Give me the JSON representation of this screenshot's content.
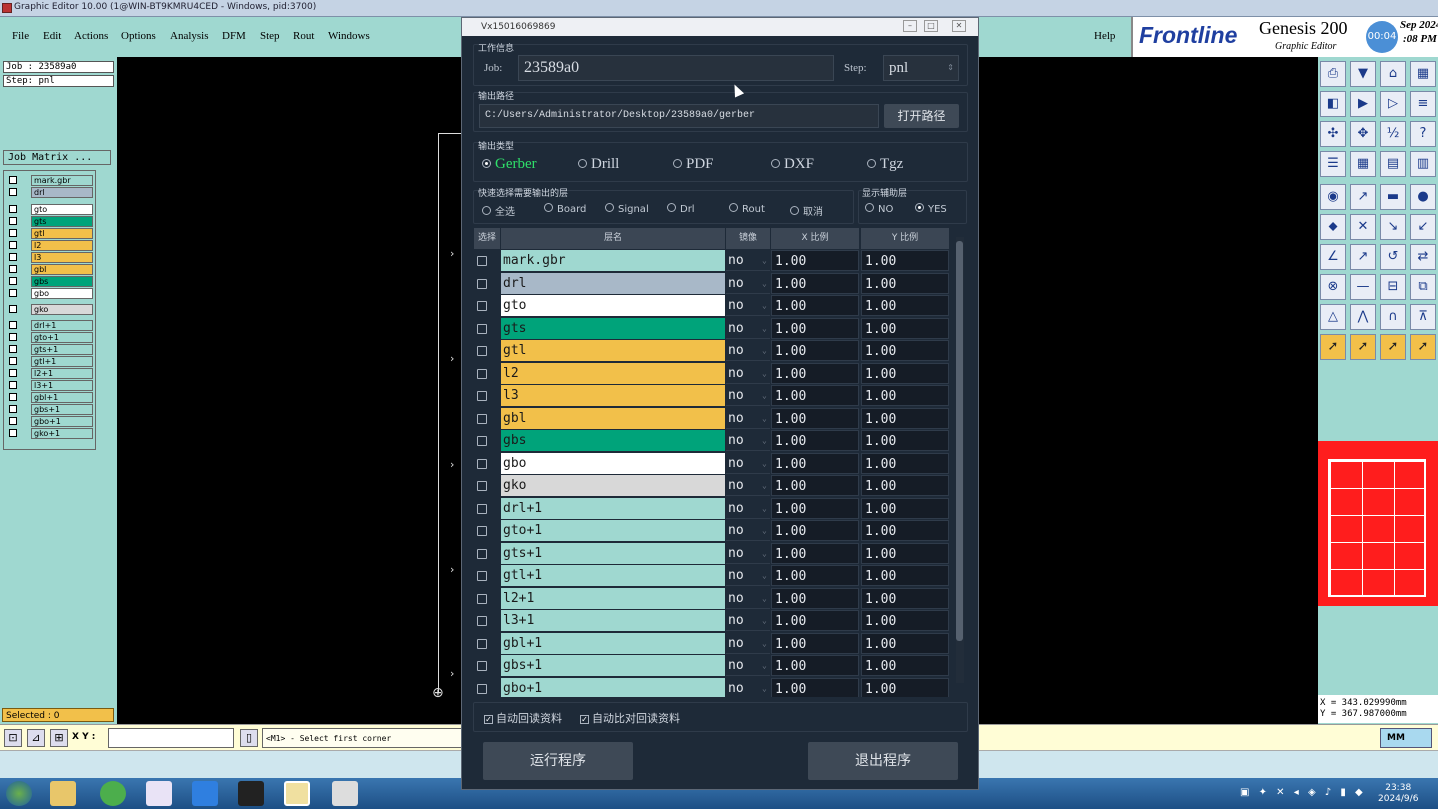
{
  "window_title": "Graphic Editor 10.00 (1@WIN-BT9KMRU4CED - Windows, pid:3700)",
  "menu": [
    "File",
    "Edit",
    "Actions",
    "Options",
    "Analysis",
    "DFM",
    "Step",
    "Rout",
    "Windows"
  ],
  "help_label": "Help",
  "logo": {
    "brand": "Frontline",
    "product": "Genesis 200",
    "sub": "Graphic Editor",
    "clock": "00:04",
    "date1": "Sep 2024",
    "date2": ":08 PM"
  },
  "left": {
    "job": "Job : 23589a0",
    "step": "Step: pnl",
    "job_matrix": "Job Matrix ...",
    "layers": [
      {
        "name": "mark.gbr",
        "color": "#9fd8d0"
      },
      {
        "name": "drl",
        "color": "#a8b8c8"
      },
      {
        "name": "gto",
        "color": "#ffffff"
      },
      {
        "name": "gts",
        "color": "#00a37a"
      },
      {
        "name": "gtl",
        "color": "#f2c04a"
      },
      {
        "name": "l2",
        "color": "#f2c04a"
      },
      {
        "name": "l3",
        "color": "#f2c04a"
      },
      {
        "name": "gbl",
        "color": "#f2c04a"
      },
      {
        "name": "gbs",
        "color": "#00a37a"
      },
      {
        "name": "gbo",
        "color": "#ffffff"
      },
      {
        "name": "gko",
        "color": "#d8d8d8"
      },
      {
        "name": "drl+1",
        "color": "#9fd8d0"
      },
      {
        "name": "gto+1",
        "color": "#9fd8d0"
      },
      {
        "name": "gts+1",
        "color": "#9fd8d0"
      },
      {
        "name": "gtl+1",
        "color": "#9fd8d0"
      },
      {
        "name": "l2+1",
        "color": "#9fd8d0"
      },
      {
        "name": "l3+1",
        "color": "#9fd8d0"
      },
      {
        "name": "gbl+1",
        "color": "#9fd8d0"
      },
      {
        "name": "gbs+1",
        "color": "#9fd8d0"
      },
      {
        "name": "gbo+1",
        "color": "#9fd8d0"
      },
      {
        "name": "gko+1",
        "color": "#9fd8d0"
      }
    ],
    "selected": "Selected : 0"
  },
  "bottom": {
    "xy_label": "X Y :",
    "hint": "<M1> - Select first corner",
    "units": "MM"
  },
  "coords": {
    "x": "X = 343.029990mm",
    "y": "Y = 367.987000mm"
  },
  "taskbar": {
    "time": "23:38",
    "date": "2024/9/6"
  },
  "dialog": {
    "title": "Vx15016069869",
    "work_info_label": "工作信息",
    "job_label": "Job:",
    "job_value": "23589a0",
    "step_label": "Step:",
    "step_value": "pnl",
    "output_path_label": "输出路径",
    "output_path": "C:/Users/Administrator/Desktop/23589a0/gerber",
    "open_path_btn": "打开路径",
    "output_type_label": "输出类型",
    "output_types": [
      {
        "label": "Gerber",
        "selected": true
      },
      {
        "label": "Drill",
        "selected": false
      },
      {
        "label": "PDF",
        "selected": false
      },
      {
        "label": "DXF",
        "selected": false
      },
      {
        "label": "Tgz",
        "selected": false
      }
    ],
    "quick_select_label": "快速选择需要输出的层",
    "quick_select": [
      "全选",
      "Board",
      "Signal",
      "Drl",
      "Rout",
      "取消"
    ],
    "show_aux_label": "显示辅助层",
    "show_aux": [
      {
        "label": "NO",
        "selected": false
      },
      {
        "label": "YES",
        "selected": true
      }
    ],
    "table_headers": {
      "select": "选择",
      "name": "层名",
      "mirror": "镜像",
      "x": "X 比例",
      "y": "Y 比例"
    },
    "rows": [
      {
        "name": "mark.gbr",
        "color": "#9fd8d0",
        "mirror": "no",
        "x": "1.00",
        "y": "1.00"
      },
      {
        "name": "drl",
        "color": "#a8b8c8",
        "mirror": "no",
        "x": "1.00",
        "y": "1.00"
      },
      {
        "name": "gto",
        "color": "#ffffff",
        "mirror": "no",
        "x": "1.00",
        "y": "1.00"
      },
      {
        "name": "gts",
        "color": "#00a37a",
        "mirror": "no",
        "x": "1.00",
        "y": "1.00"
      },
      {
        "name": "gtl",
        "color": "#f2c04a",
        "mirror": "no",
        "x": "1.00",
        "y": "1.00"
      },
      {
        "name": "l2",
        "color": "#f2c04a",
        "mirror": "no",
        "x": "1.00",
        "y": "1.00"
      },
      {
        "name": "l3",
        "color": "#f2c04a",
        "mirror": "no",
        "x": "1.00",
        "y": "1.00"
      },
      {
        "name": "gbl",
        "color": "#f2c04a",
        "mirror": "no",
        "x": "1.00",
        "y": "1.00"
      },
      {
        "name": "gbs",
        "color": "#00a37a",
        "mirror": "no",
        "x": "1.00",
        "y": "1.00"
      },
      {
        "name": "gbo",
        "color": "#ffffff",
        "mirror": "no",
        "x": "1.00",
        "y": "1.00"
      },
      {
        "name": "gko",
        "color": "#d8d8d8",
        "mirror": "no",
        "x": "1.00",
        "y": "1.00"
      },
      {
        "name": "drl+1",
        "color": "#9fd8d0",
        "mirror": "no",
        "x": "1.00",
        "y": "1.00"
      },
      {
        "name": "gto+1",
        "color": "#9fd8d0",
        "mirror": "no",
        "x": "1.00",
        "y": "1.00"
      },
      {
        "name": "gts+1",
        "color": "#9fd8d0",
        "mirror": "no",
        "x": "1.00",
        "y": "1.00"
      },
      {
        "name": "gtl+1",
        "color": "#9fd8d0",
        "mirror": "no",
        "x": "1.00",
        "y": "1.00"
      },
      {
        "name": "l2+1",
        "color": "#9fd8d0",
        "mirror": "no",
        "x": "1.00",
        "y": "1.00"
      },
      {
        "name": "l3+1",
        "color": "#9fd8d0",
        "mirror": "no",
        "x": "1.00",
        "y": "1.00"
      },
      {
        "name": "gbl+1",
        "color": "#9fd8d0",
        "mirror": "no",
        "x": "1.00",
        "y": "1.00"
      },
      {
        "name": "gbs+1",
        "color": "#9fd8d0",
        "mirror": "no",
        "x": "1.00",
        "y": "1.00"
      },
      {
        "name": "gbo+1",
        "color": "#9fd8d0",
        "mirror": "no",
        "x": "1.00",
        "y": "1.00"
      }
    ],
    "auto_read": "自动回读资料",
    "auto_compare": "自动比对回读资料",
    "run_btn": "运行程序",
    "exit_btn": "退出程序"
  }
}
